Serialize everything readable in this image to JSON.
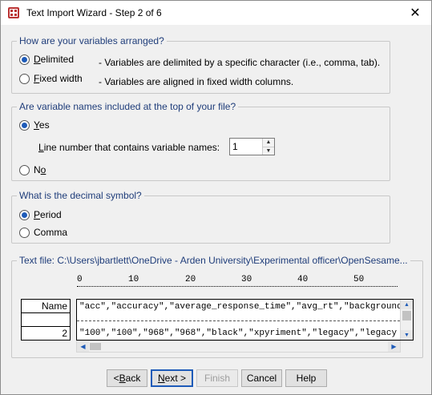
{
  "window": {
    "title": "Text Import Wizard - Step 2 of 6",
    "close_symbol": "✕"
  },
  "arrangement": {
    "legend": "How are your variables arranged?",
    "options": [
      {
        "label": "Delimited",
        "description": "- Variables are delimited by a specific character (i.e., comma, tab).",
        "checked": true
      },
      {
        "label": "Fixed width",
        "description": "- Variables are aligned in fixed width columns.",
        "checked": false
      }
    ]
  },
  "names": {
    "legend": "Are variable names included at the top of your file?",
    "yes_label": "Yes",
    "no_label": "No",
    "selected": "Yes",
    "line_number_label": "Line number that contains variable names:",
    "line_number_value": "1"
  },
  "decimal": {
    "legend": "What is the decimal symbol?",
    "options": [
      {
        "label": "Period",
        "checked": true
      },
      {
        "label": "Comma",
        "checked": false
      }
    ]
  },
  "preview": {
    "legend": "Text file:  C:\\Users\\jbartlett\\OneDrive - Arden University\\Experimental officer\\OpenSesame...",
    "ruler_marks": [
      "0",
      "10",
      "20",
      "30",
      "40",
      "50"
    ],
    "row_headers": [
      "Name",
      "",
      "2"
    ],
    "lines": [
      "\"acc\",\"accuracy\",\"average_response_time\",\"avg_rt\",\"background",
      "\"100\",\"100\",\"968\",\"968\",\"black\",\"xpyriment\",\"legacy\",\"legacy"
    ]
  },
  "buttons": {
    "back": "< Back",
    "next": "Next >",
    "finish": "Finish",
    "cancel": "Cancel",
    "help": "Help"
  },
  "colors": {
    "legend_text": "#1f3d7a",
    "accent": "#1e5bb8",
    "window_bg": "#f0f0f0"
  }
}
